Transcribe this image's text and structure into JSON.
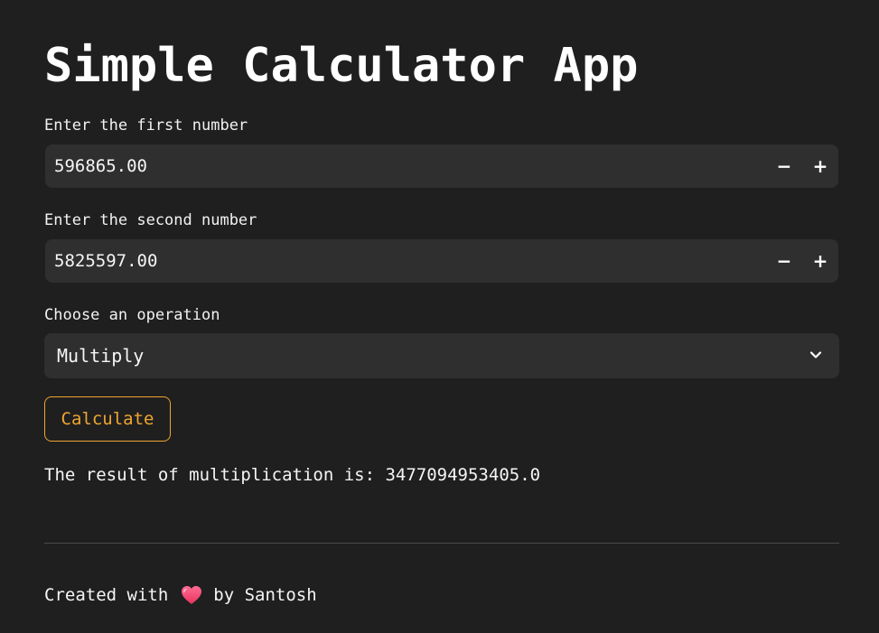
{
  "title": "Simple Calculator App",
  "first_number": {
    "label": "Enter the first number",
    "value": "596865.00",
    "decrement": "−",
    "increment": "+"
  },
  "second_number": {
    "label": "Enter the second number",
    "value": "5825597.00",
    "decrement": "−",
    "increment": "+"
  },
  "operation": {
    "label": "Choose an operation",
    "selected": "Multiply",
    "icon": "chevron-down-icon"
  },
  "calculate_button": "Calculate",
  "result_text": "The result of multiplication is: 3477094953405.0",
  "footer": {
    "prefix": "Created with",
    "suffix": "by Santosh",
    "icon": "heart-icon"
  },
  "colors": {
    "background": "#1f1f1f",
    "input_background": "#2f2f2f",
    "accent": "#f0a531",
    "heart": "#ff4b7d"
  }
}
